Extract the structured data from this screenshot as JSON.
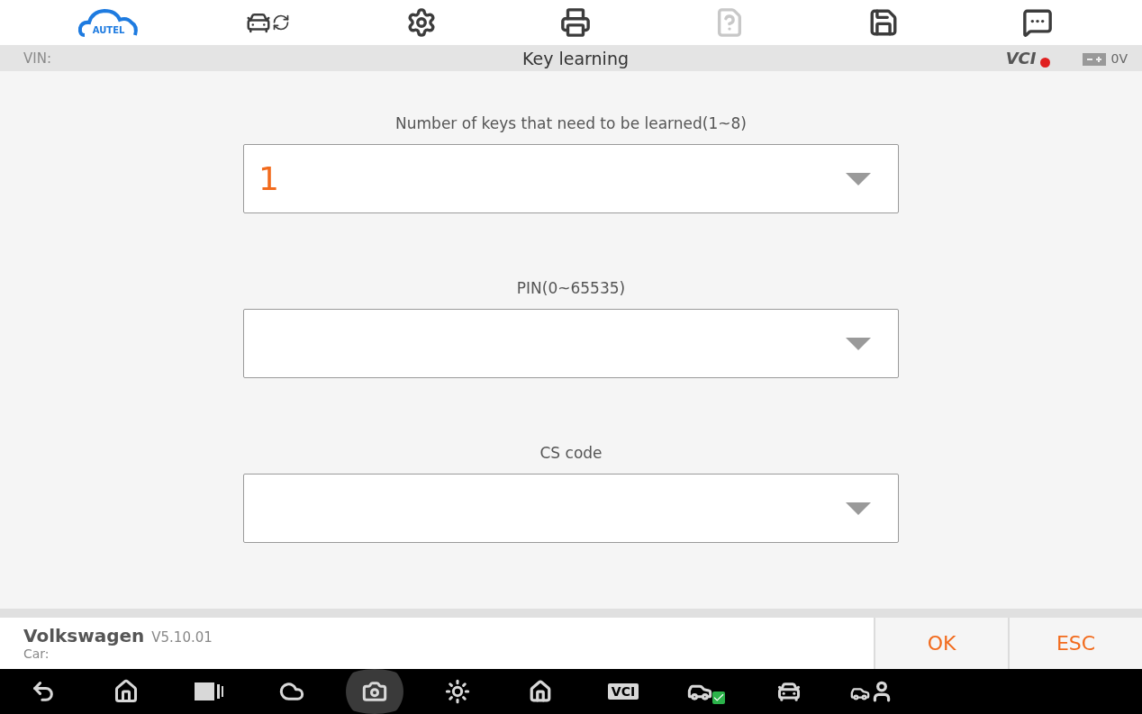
{
  "toolbar": {
    "logo": "AUTEL",
    "items": [
      {
        "kind": "switch-car",
        "disabled": false
      },
      {
        "kind": "settings",
        "disabled": false
      },
      {
        "kind": "print",
        "disabled": false
      },
      {
        "kind": "help",
        "disabled": true
      },
      {
        "kind": "save",
        "disabled": false
      },
      {
        "kind": "message",
        "disabled": false
      }
    ]
  },
  "header": {
    "vin_label": "VIN:",
    "title": "Key learning",
    "vci": "VCI",
    "voltage": "0V"
  },
  "fields": [
    {
      "label": "Number of keys that need to be learned(1~8)",
      "value": "1"
    },
    {
      "label": "PIN(0~65535)"
    },
    {
      "label": "CS code"
    }
  ],
  "footer": {
    "make": "Volkswagen",
    "version": "V5.10.01",
    "car_label": "Car:",
    "buttons": [
      "OK",
      "ESC"
    ]
  },
  "nav": [
    {
      "kind": "back",
      "selected": false
    },
    {
      "kind": "home",
      "selected": false
    },
    {
      "kind": "recent",
      "selected": false
    },
    {
      "kind": "cloud",
      "selected": false
    },
    {
      "kind": "camera",
      "selected": true
    },
    {
      "kind": "display",
      "selected": false
    },
    {
      "kind": "house",
      "selected": false
    },
    {
      "kind": "vci",
      "label": "VCI",
      "selected": false
    },
    {
      "kind": "car-key",
      "selected": false
    },
    {
      "kind": "car",
      "selected": false
    },
    {
      "kind": "car-tech",
      "selected": false
    }
  ]
}
